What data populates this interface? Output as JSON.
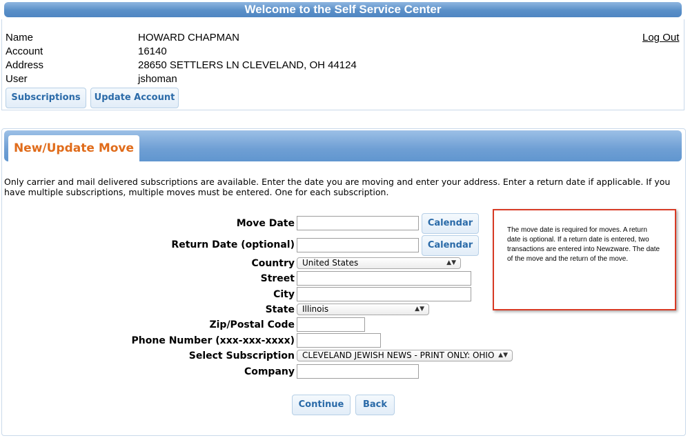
{
  "header": {
    "title": "Welcome to the Self Service Center"
  },
  "account_info": {
    "labels": {
      "name": "Name",
      "account": "Account",
      "address": "Address",
      "user": "User"
    },
    "values": {
      "name": "HOWARD CHAPMAN",
      "account": "16140",
      "address": "28650 SETTLERS LN CLEVELAND, OH 44124",
      "user": "jshoman"
    },
    "logout_label": "Log Out"
  },
  "nav": {
    "subscriptions_label": "Subscriptions",
    "update_account_label": "Update Account"
  },
  "section": {
    "tab_label": "New/Update Move",
    "intro": "Only carrier and mail delivered subscriptions are available. Enter the date you are moving and enter your address. Enter a return date if applicable. If you have multiple subscriptions, multiple moves must be entered. One for each subscription."
  },
  "form": {
    "move_date": {
      "label": "Move Date",
      "value": ""
    },
    "return_date": {
      "label": "Return Date (optional)",
      "value": ""
    },
    "calendar_label": "Calendar",
    "country": {
      "label": "Country",
      "value": "United States"
    },
    "street": {
      "label": "Street",
      "value": ""
    },
    "city": {
      "label": "City",
      "value": ""
    },
    "state": {
      "label": "State",
      "value": "Illinois"
    },
    "zip": {
      "label": "Zip/Postal Code",
      "value": ""
    },
    "phone": {
      "label": "Phone Number (xxx-xxx-xxxx)",
      "value": ""
    },
    "subscription": {
      "label": "Select Subscription",
      "value": "CLEVELAND JEWISH NEWS - PRINT ONLY: OHIO"
    },
    "company": {
      "label": "Company",
      "value": ""
    },
    "continue_label": "Continue",
    "back_label": "Back"
  },
  "annotation": {
    "text": "The move date is required for moves.  A return date is optional.  If a return date is entered, two transactions are entered into Newzware.  The date of the move and the return of the move.",
    "border_color": "#d83a24"
  },
  "colors": {
    "header_blue": "#5a8fc8",
    "tab_orange": "#e06c1b",
    "button_text": "#2a6aa8"
  }
}
